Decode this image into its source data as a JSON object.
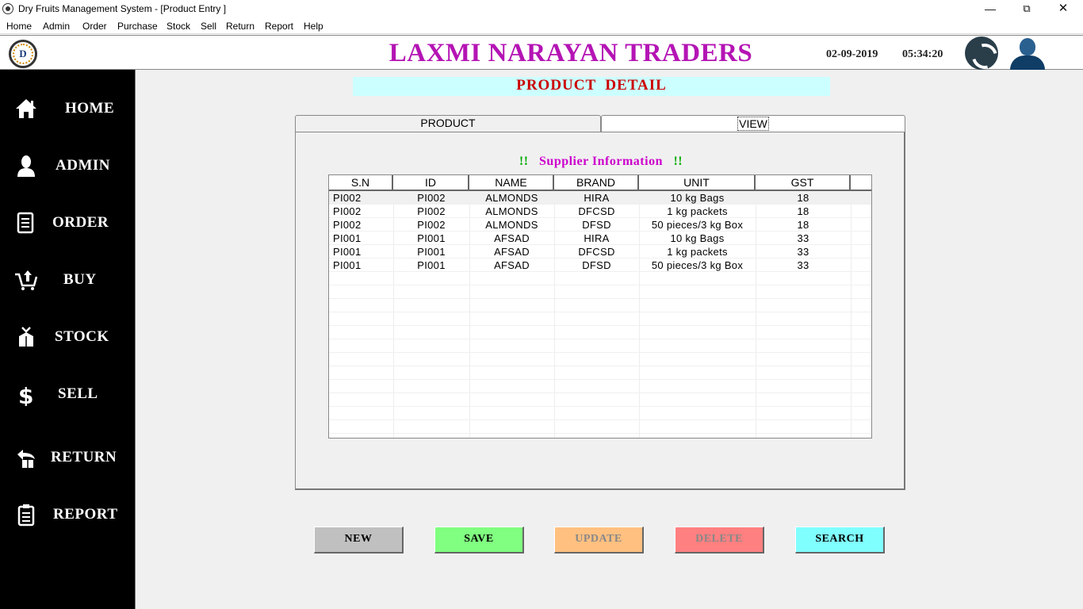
{
  "window": {
    "title": "Dry Fruits Management System - [Product Entry ]",
    "minimize": "—",
    "maximize": "⧉",
    "close": "✕"
  },
  "menu": [
    "Home",
    "Admin",
    "Order",
    "Purchase",
    "Stock",
    "Sell",
    "Return",
    "Report",
    "Help"
  ],
  "header": {
    "logo_letter": "D",
    "company": "LAXMI NARAYAN TRADERS",
    "date": "02-09-2019",
    "time": "05:34:20"
  },
  "sidebar": [
    {
      "label": "HOME",
      "icon": "home-icon"
    },
    {
      "label": "ADMIN",
      "icon": "user-icon"
    },
    {
      "label": "ORDER",
      "icon": "document-icon"
    },
    {
      "label": "BUY",
      "icon": "cart-icon"
    },
    {
      "label": "STOCK",
      "icon": "box-icon"
    },
    {
      "label": "SELL",
      "icon": "dollar-icon"
    },
    {
      "label": "RETURN",
      "icon": "return-icon"
    },
    {
      "label": "REPORT",
      "icon": "clipboard-icon"
    }
  ],
  "banner": "PRODUCT  DETAIL",
  "tabs": {
    "product": "PRODUCT",
    "view": "VIEW"
  },
  "supplier_title": {
    "bang": "!!",
    "text": "Supplier Information"
  },
  "table": {
    "columns": [
      "S.N",
      "ID",
      "NAME",
      "BRAND",
      "UNIT",
      "GST"
    ],
    "rows": [
      [
        "PI002",
        "PI002",
        "ALMONDS",
        "HIRA",
        "10 kg Bags",
        "18"
      ],
      [
        "PI002",
        "PI002",
        "ALMONDS",
        "DFCSD",
        "1 kg packets",
        "18"
      ],
      [
        "PI002",
        "PI002",
        "ALMONDS",
        "DFSD",
        "50 pieces/3 kg Box",
        "18"
      ],
      [
        "PI001",
        "PI001",
        "AFSAD",
        "HIRA",
        "10 kg Bags",
        "33"
      ],
      [
        "PI001",
        "PI001",
        "AFSAD",
        "DFCSD",
        "1 kg packets",
        "33"
      ],
      [
        "PI001",
        "PI001",
        "AFSAD",
        "DFSD",
        "50 pieces/3 kg Box",
        "33"
      ]
    ]
  },
  "buttons": {
    "new": "NEW",
    "save": "SAVE",
    "update": "UPDATE",
    "delete": "DELETE",
    "search": "SEARCH"
  }
}
